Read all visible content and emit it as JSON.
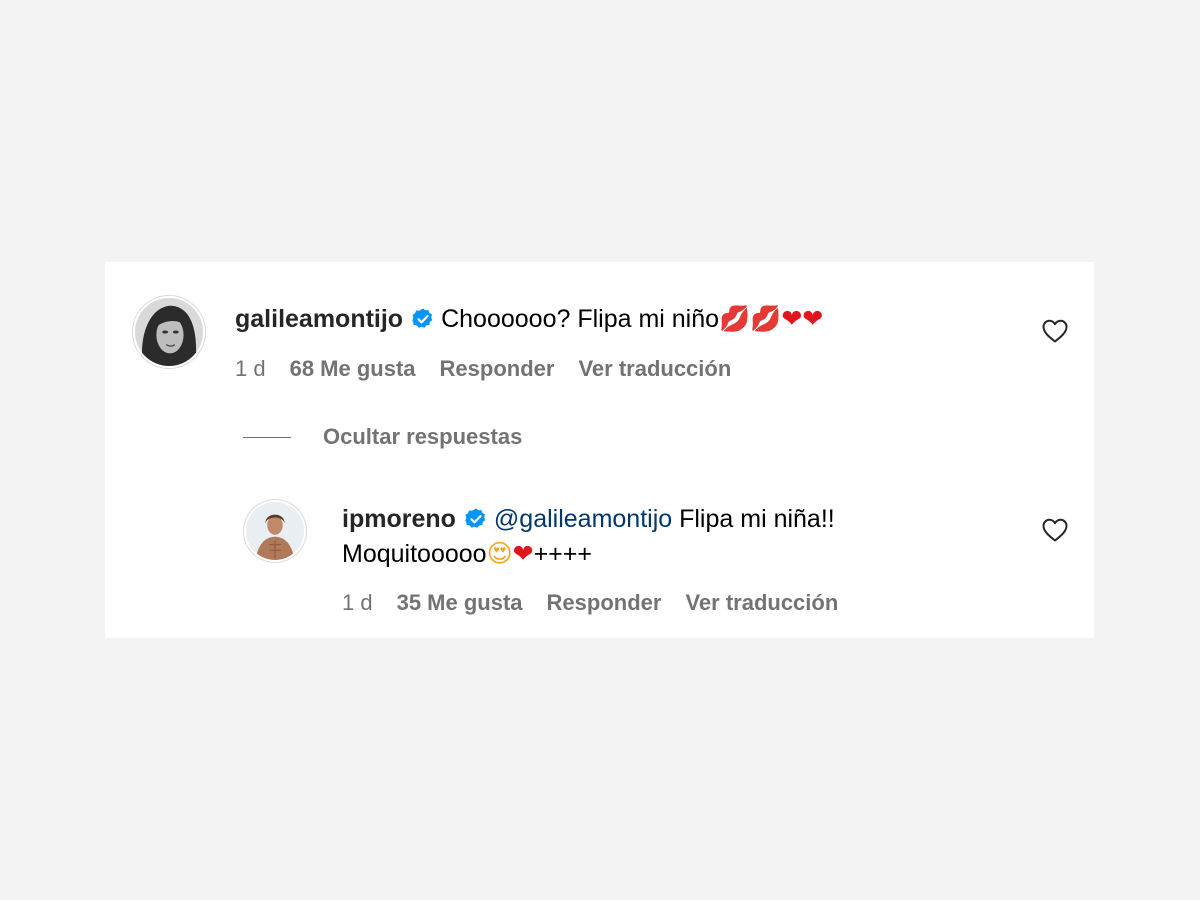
{
  "comment": {
    "username": "galileamontijo",
    "text": "Choooooo? Flipa mi niño",
    "emojis": {
      "kiss_1": "💋",
      "kiss_2": "💋",
      "heart_1": "❤",
      "heart_2": "❤"
    },
    "time": "1 d",
    "likes": "68 Me gusta",
    "reply_label": "Responder",
    "translate_label": "Ver traducción"
  },
  "hide_replies_label": "Ocultar respuestas",
  "reply": {
    "username": "ipmoreno",
    "mention": "@galileamontijo",
    "text_line1": "Flipa mi niña!!",
    "text_line2": "Moquitooooo",
    "emojis": {
      "face": "😍",
      "heart": "❤"
    },
    "suffix": "++++",
    "time": "1 d",
    "likes": "35 Me gusta",
    "reply_label": "Responder",
    "translate_label": "Ver traducción"
  },
  "icons": {
    "verified": "verified-badge-icon",
    "like": "heart-outline-icon"
  },
  "colors": {
    "background": "#f3f3f3",
    "card": "#ffffff",
    "verified_blue": "#0095f6",
    "mention": "#00376b",
    "secondary_text": "#737373"
  }
}
